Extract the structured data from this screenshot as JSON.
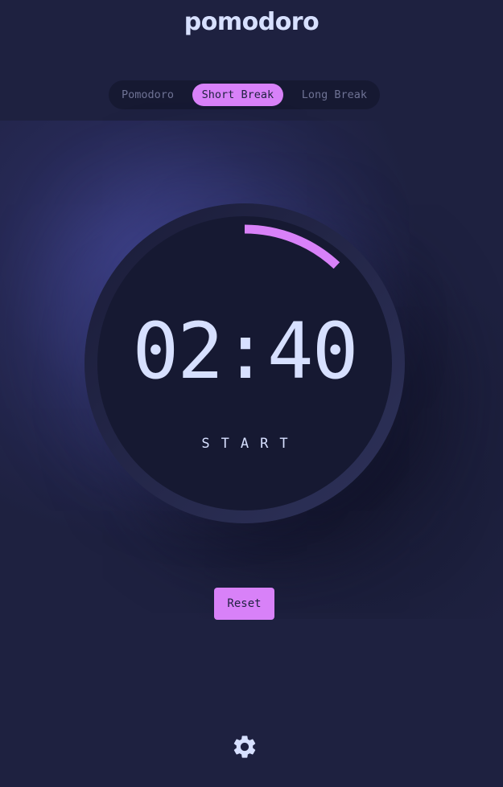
{
  "app": {
    "title": "pomodoro"
  },
  "mode_tabs": {
    "items": [
      {
        "label": "Pomodoro",
        "active": false
      },
      {
        "label": "Short Break",
        "active": true
      },
      {
        "label": "Long Break",
        "active": false
      }
    ]
  },
  "timer": {
    "time_remaining": "02:40",
    "start_label": "START",
    "progress_fraction": 0.12
  },
  "controls": {
    "reset_label": "Reset"
  },
  "icons": {
    "settings": "gear-icon"
  },
  "theme": {
    "accent": "#d881f8",
    "background": "#1e2140",
    "text": "#d7e0ff",
    "dark_panel": "#161932"
  }
}
